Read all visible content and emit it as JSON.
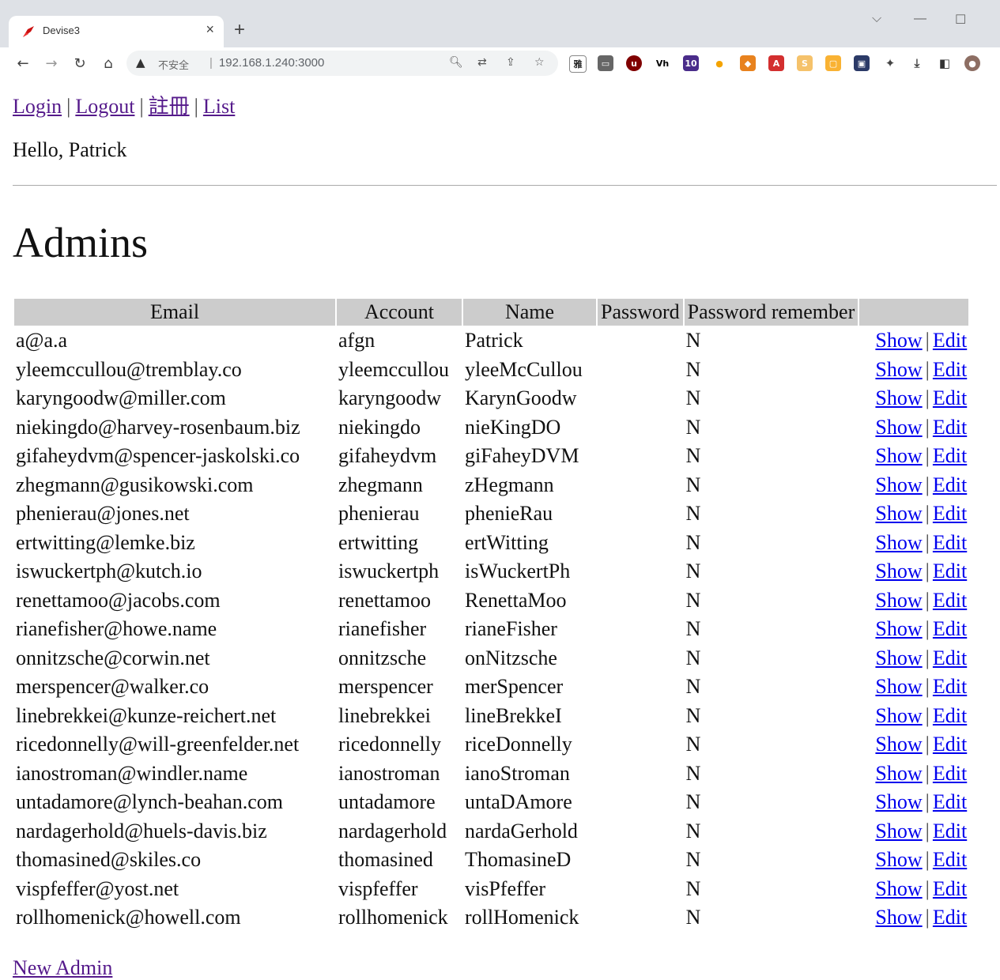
{
  "browser": {
    "tab_title": "Devise3",
    "new_tab_label": "+",
    "close_label": "×",
    "insecure_label": "不安全",
    "url": "192.168.1.240:3000",
    "ext_badge": "10",
    "ext_ya_label": "雅",
    "ext_vh_label": "Vh"
  },
  "nav": {
    "login": "Login",
    "logout": "Logout",
    "register": "註冊",
    "list": "List",
    "separator": "|"
  },
  "greeting": "Hello, Patrick",
  "page_title": "Admins",
  "table": {
    "headers": [
      "Email",
      "Account",
      "Name",
      "Password",
      "Password remember",
      ""
    ],
    "show_label": "Show",
    "edit_label": "Edit",
    "rows": [
      {
        "email": "a@a.a",
        "account": "afgn",
        "name": "Patrick",
        "password": "",
        "remember": "N"
      },
      {
        "email": "yleemccullou@tremblay.co",
        "account": "yleemccullou",
        "name": "yleeMcCullou",
        "password": "",
        "remember": "N"
      },
      {
        "email": "karyngoodw@miller.com",
        "account": "karyngoodw",
        "name": "KarynGoodw",
        "password": "",
        "remember": "N"
      },
      {
        "email": "niekingdo@harvey-rosenbaum.biz",
        "account": "niekingdo",
        "name": "nieKingDO",
        "password": "",
        "remember": "N"
      },
      {
        "email": "gifaheydvm@spencer-jaskolski.co",
        "account": "gifaheydvm",
        "name": "giFaheyDVM",
        "password": "",
        "remember": "N"
      },
      {
        "email": "zhegmann@gusikowski.com",
        "account": "zhegmann",
        "name": "zHegmann",
        "password": "",
        "remember": "N"
      },
      {
        "email": "phenierau@jones.net",
        "account": "phenierau",
        "name": "phenieRau",
        "password": "",
        "remember": "N"
      },
      {
        "email": "ertwitting@lemke.biz",
        "account": "ertwitting",
        "name": "ertWitting",
        "password": "",
        "remember": "N"
      },
      {
        "email": "iswuckertph@kutch.io",
        "account": "iswuckertph",
        "name": "isWuckertPh",
        "password": "",
        "remember": "N"
      },
      {
        "email": "renettamoo@jacobs.com",
        "account": "renettamoo",
        "name": "RenettaMoo",
        "password": "",
        "remember": "N"
      },
      {
        "email": "rianefisher@howe.name",
        "account": "rianefisher",
        "name": "rianeFisher",
        "password": "",
        "remember": "N"
      },
      {
        "email": "onnitzsche@corwin.net",
        "account": "onnitzsche",
        "name": "onNitzsche",
        "password": "",
        "remember": "N"
      },
      {
        "email": "merspencer@walker.co",
        "account": "merspencer",
        "name": "merSpencer",
        "password": "",
        "remember": "N"
      },
      {
        "email": "linebrekkei@kunze-reichert.net",
        "account": "linebrekkei",
        "name": "lineBrekkeI",
        "password": "",
        "remember": "N"
      },
      {
        "email": "ricedonnelly@will-greenfelder.net",
        "account": "ricedonnelly",
        "name": "riceDonnelly",
        "password": "",
        "remember": "N"
      },
      {
        "email": "ianostroman@windler.name",
        "account": "ianostroman",
        "name": "ianoStroman",
        "password": "",
        "remember": "N"
      },
      {
        "email": "untadamore@lynch-beahan.com",
        "account": "untadamore",
        "name": "untaDAmore",
        "password": "",
        "remember": "N"
      },
      {
        "email": "nardagerhold@huels-davis.biz",
        "account": "nardagerhold",
        "name": "nardaGerhold",
        "password": "",
        "remember": "N"
      },
      {
        "email": "thomasined@skiles.co",
        "account": "thomasined",
        "name": "ThomasineD",
        "password": "",
        "remember": "N"
      },
      {
        "email": "vispfeffer@yost.net",
        "account": "vispfeffer",
        "name": "visPfeffer",
        "password": "",
        "remember": "N"
      },
      {
        "email": "rollhomenick@howell.com",
        "account": "rollhomenick",
        "name": "rollHomenick",
        "password": "",
        "remember": "N"
      }
    ]
  },
  "new_admin": "New Admin",
  "colors": {
    "link_visited": "#551a8b",
    "link": "#0000ee",
    "header_bg": "#cccccc"
  }
}
